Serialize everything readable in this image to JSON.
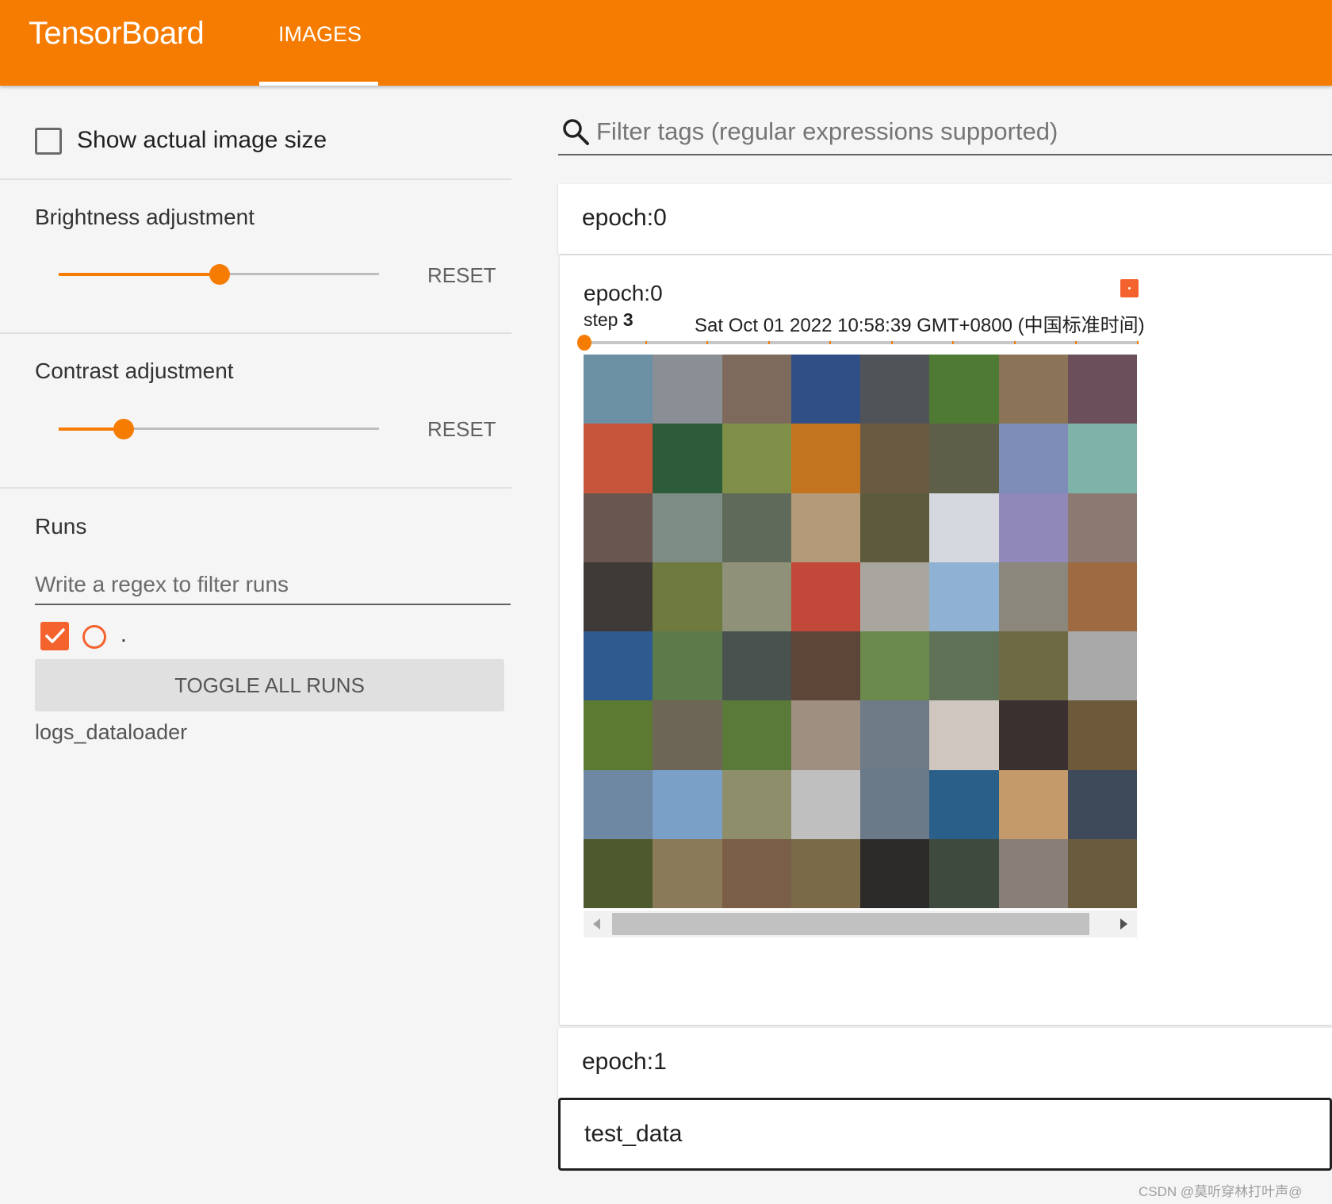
{
  "header": {
    "brand": "TensorBoard",
    "tabs": [
      {
        "label": "IMAGES",
        "active": true
      }
    ],
    "accent_color": "#f57c00"
  },
  "sidebar": {
    "show_actual_size": {
      "label": "Show actual image size",
      "checked": false
    },
    "brightness": {
      "label": "Brightness adjustment",
      "value_fraction": 0.5,
      "reset_label": "RESET"
    },
    "contrast": {
      "label": "Contrast adjustment",
      "value_fraction": 0.2,
      "reset_label": "RESET"
    },
    "runs": {
      "title": "Runs",
      "filter_placeholder": "Write a regex to filter runs",
      "items": [
        {
          "name": ".",
          "checked": true,
          "color": "#f4622e"
        }
      ],
      "toggle_label": "TOGGLE ALL RUNS",
      "logdir": "logs_dataloader"
    }
  },
  "main": {
    "filter_placeholder": "Filter tags (regular expressions supported)",
    "sections": [
      {
        "title": "epoch:0",
        "expanded": true
      },
      {
        "title": "epoch:1",
        "expanded": false
      },
      {
        "title": "test_data",
        "expanded": false,
        "focused": true
      }
    ],
    "card": {
      "title": "epoch:0",
      "step_label": "step",
      "step_value": "3",
      "timestamp": "Sat Oct 01 2022 10:58:39 GMT+0800 (中国标准时间)",
      "step_slider_fraction": 0.0,
      "step_ticks": 10,
      "image_grid_size": "8x8",
      "image_grid_colors": [
        "#6b8fa3",
        "#8a8f96",
        "#7d6a5c",
        "#2f4f86",
        "#505357",
        "#4f7a33",
        "#8a7356",
        "#6b4f5a",
        "#c7553b",
        "#2e5c3a",
        "#7f8f4a",
        "#c2741f",
        "#6a5a42",
        "#5d5f48",
        "#7d8db8",
        "#7fb2a8",
        "#6a5650",
        "#7e8c86",
        "#5f6a5a",
        "#b49a78",
        "#5e5a3e",
        "#d4d8de",
        "#8f88b8",
        "#8c7a72",
        "#3e3a38",
        "#6f7a3e",
        "#8f9278",
        "#c2493a",
        "#a8a69e",
        "#8fb2d4",
        "#8c877c",
        "#9e6a42",
        "#2f5a8f",
        "#5d7a4a",
        "#4a5250",
        "#5c4638",
        "#6a8a4e",
        "#5f7258",
        "#6e6a44",
        "#a9a9a9",
        "#5d7a32",
        "#6d6656",
        "#5a7a3a",
        "#9e8f80",
        "#6e7a86",
        "#cfc6c0",
        "#3a3030",
        "#6d5a3a",
        "#6e88a3",
        "#7aa0c8",
        "#8e8f6a",
        "#bfbfbf",
        "#6a7a88",
        "#2a5f8a",
        "#c59a6a",
        "#3e4a5a",
        "#4e5a2e",
        "#8a7a5a",
        "#7a5e48",
        "#7a6a48",
        "#2d2a2a",
        "#3e4a3e",
        "#8a7e78",
        "#6a5a3e"
      ]
    },
    "scrollbar": {
      "position_fraction": 0.0
    }
  },
  "watermark": "CSDN @莫听穿林打叶声@"
}
